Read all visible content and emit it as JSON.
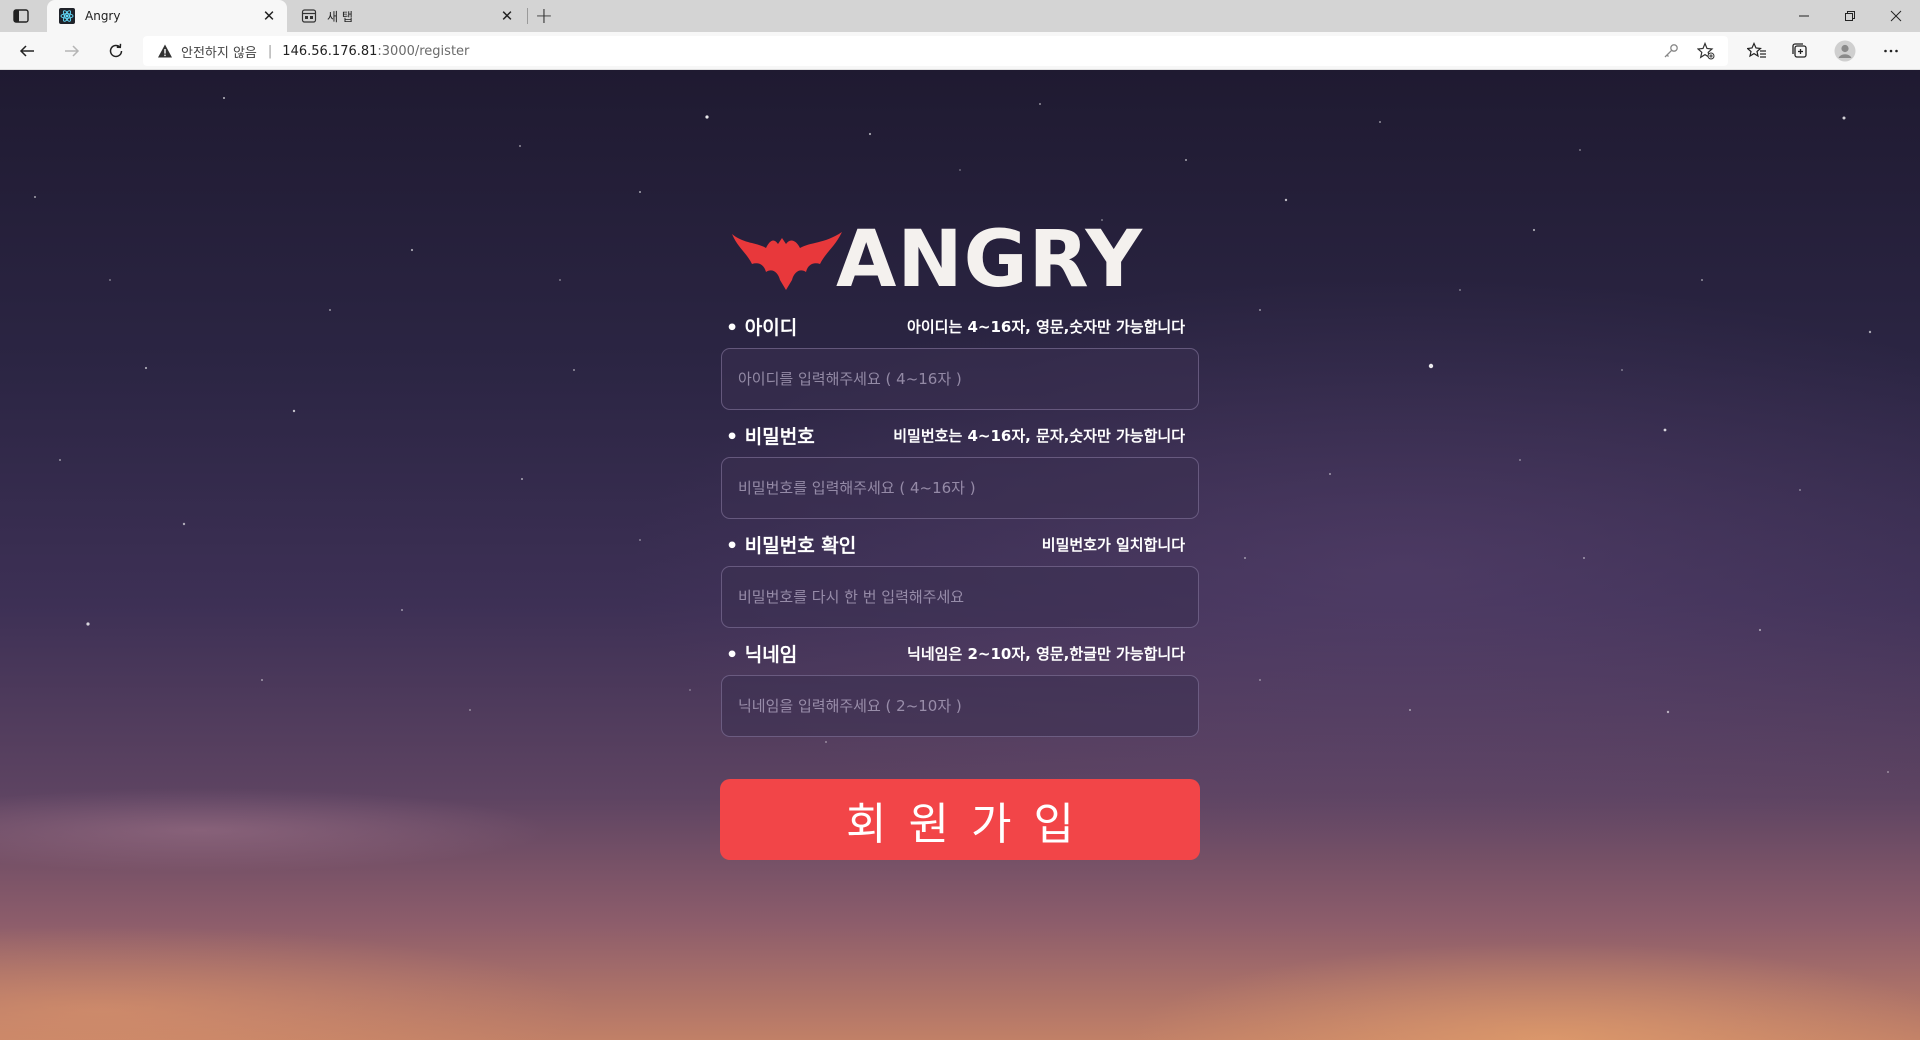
{
  "browser": {
    "tabs": [
      {
        "title": "Angry",
        "active": true
      },
      {
        "title": "새 탭",
        "active": false
      }
    ],
    "address": {
      "security_label": "안전하지 않음",
      "url_host": "146.56.176.81",
      "url_path": ":3000/register"
    }
  },
  "logo": {
    "text": "ANGRY",
    "bat_color": "#e8383b"
  },
  "form": {
    "fields": [
      {
        "label": "• 아이디",
        "hint": "아이디는 4~16자, 영문,숫자만 가능합니다",
        "placeholder": "아이디를 입력해주세요 ( 4~16자 )",
        "value": ""
      },
      {
        "label": "• 비밀번호",
        "hint": "비밀번호는 4~16자, 문자,숫자만 가능합니다",
        "placeholder": "비밀번호를 입력해주세요 ( 4~16자 )",
        "value": ""
      },
      {
        "label": "• 비밀번호 확인",
        "hint": "비밀번호가 일치합니다",
        "placeholder": "비밀번호를 다시 한 번 입력해주세요",
        "value": ""
      },
      {
        "label": "• 닉네임",
        "hint": "닉네임은 2~10자, 영문,한글만 가능합니다",
        "placeholder": "닉네임을 입력해주세요 ( 2~10자 )",
        "value": ""
      }
    ],
    "submit_label": "회원가입",
    "submit_color": "#f24548"
  }
}
